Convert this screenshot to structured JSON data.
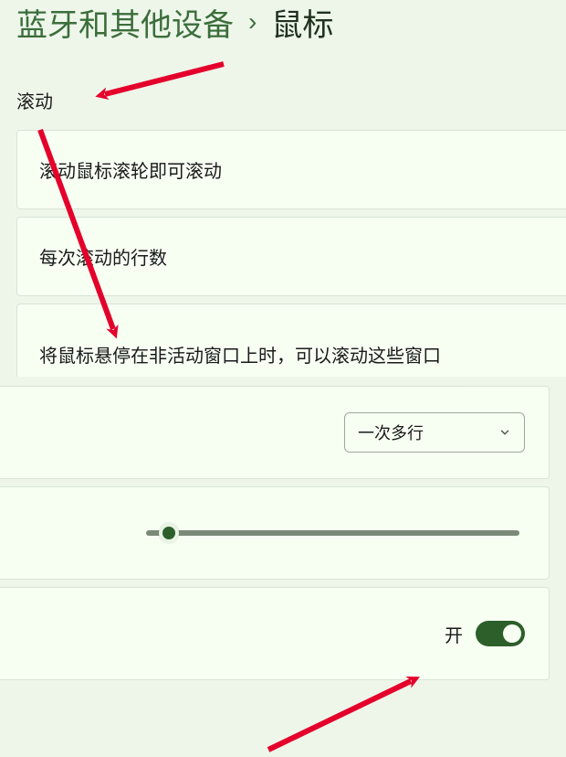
{
  "breadcrumb": {
    "parent": "蓝牙和其他设备",
    "separator": "›",
    "current": "鼠标"
  },
  "sections": {
    "scroll": {
      "label": "滚动",
      "row1": "滚动鼠标滚轮即可滚动",
      "row2": "每次滚动的行数",
      "row3": "将鼠标悬停在非活动窗口上时，可以滚动这些窗口"
    }
  },
  "controls": {
    "dropdown_value": "一次多行",
    "toggle_label": "开"
  },
  "colors": {
    "page_bg": "#eef6ea",
    "card_bg": "#f7fff3",
    "accent": "#2d5f2b",
    "breadcrumb": "#3b6e3b",
    "annotation": "#e4002b"
  }
}
